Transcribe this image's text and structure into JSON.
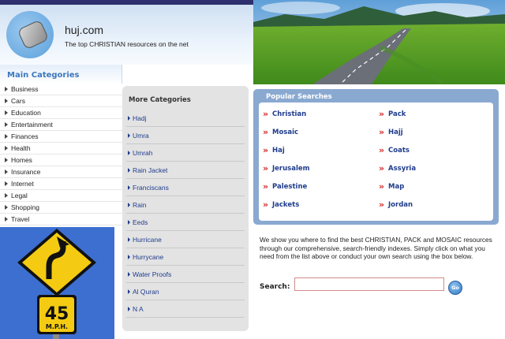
{
  "header": {
    "site_name": "huj.com",
    "tagline": "The top CHRISTIAN resources on the net"
  },
  "sidebar": {
    "title": "Main Categories",
    "items": [
      "Business",
      "Cars",
      "Education",
      "Entertainment",
      "Finances",
      "Health",
      "Homes",
      "Insurance",
      "Internet",
      "Legal",
      "Shopping",
      "Travel"
    ]
  },
  "road_sign": {
    "speed": "45",
    "unit": "M.P.H."
  },
  "more_categories": {
    "title": "More Categories",
    "items": [
      "Hadj",
      "Umra",
      "Umrah",
      "Rain Jacket",
      "Franciscans",
      "Rain",
      "Eeds",
      "Hurricane",
      "Hurrycane",
      "Water Proofs",
      "Al Quran",
      "N A"
    ]
  },
  "popular_searches": {
    "title": "Popular Searches",
    "left": [
      "Christian",
      "Mosaic",
      "Haj",
      "Jerusalem",
      "Palestine",
      "Jackets"
    ],
    "right": [
      "Pack",
      "Hajj",
      "Coats",
      "Assyria",
      "Map",
      "Jordan"
    ]
  },
  "description": "We show you where to find the best CHRISTIAN, PACK and MOSAIC resources through our comprehensive, search-friendly indexes. Simply click on what you need from the list above or conduct your own search using the box below.",
  "search": {
    "label": "Search:",
    "value": "",
    "go_label": "Go"
  },
  "colors": {
    "top_strip": "#2e2f6e",
    "link": "#1f3c8c",
    "accent": "#3b77bd",
    "arrow": "#d32828"
  }
}
